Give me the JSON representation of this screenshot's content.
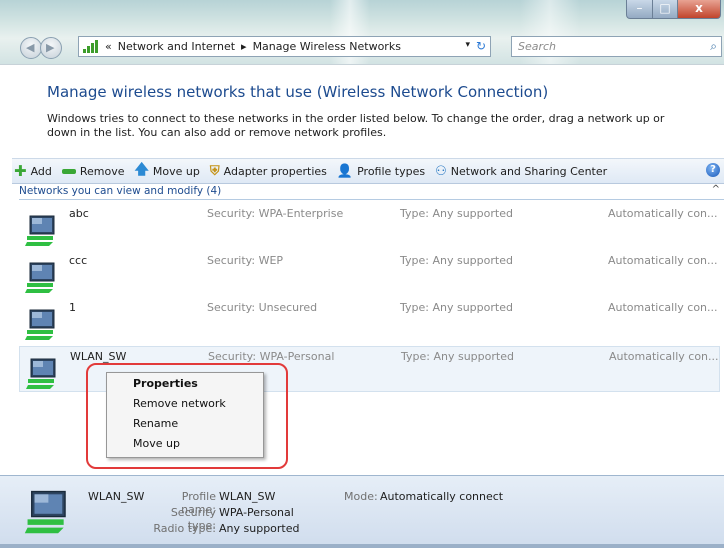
{
  "window": {
    "controls": {
      "minimize": "–",
      "maximize": "□",
      "close": "x"
    }
  },
  "address_bar": {
    "prefix": "«",
    "crumbs": [
      "Network and Internet",
      "Manage Wireless Networks"
    ],
    "separator": "▸",
    "dropdown_icon": "▾",
    "refresh_icon": "↻"
  },
  "search": {
    "placeholder": "Search",
    "icon": "⌕"
  },
  "page": {
    "title": "Manage wireless networks that use (Wireless Network Connection)",
    "description": "Windows tries to connect to these networks in the order listed below. To change the order, drag a network up or down in the list. You can also add or remove network profiles."
  },
  "toolbar": {
    "add": "Add",
    "remove": "Remove",
    "move_up": "Move up",
    "adapter_properties": "Adapter properties",
    "profile_types": "Profile types",
    "network_sharing_center": "Network and Sharing Center",
    "help": "?"
  },
  "group": {
    "label": "Networks you can view and modify (4)",
    "caret": "^"
  },
  "networks": [
    {
      "name": "abc",
      "security": "Security: WPA-Enterprise",
      "type": "Type: Any supported",
      "mode": "Automatically con..."
    },
    {
      "name": "ccc",
      "security": "Security: WEP",
      "type": "Type: Any supported",
      "mode": "Automatically con..."
    },
    {
      "name": "1",
      "security": "Security: Unsecured",
      "type": "Type: Any supported",
      "mode": "Automatically con..."
    },
    {
      "name": "WLAN_SW",
      "security": "Security: WPA-Personal",
      "type": "Type: Any supported",
      "mode": "Automatically con..."
    }
  ],
  "context_menu": {
    "items": [
      "Properties",
      "Remove network",
      "Rename",
      "Move up"
    ]
  },
  "details": {
    "name": "WLAN_SW",
    "profile_name_label": "Profile name:",
    "profile_name": "WLAN_SW",
    "security_type_label": "Security type:",
    "security_type": "WPA-Personal",
    "radio_type_label": "Radio type:",
    "radio_type": "Any supported",
    "mode_label": "Mode:",
    "mode": "Automatically connect"
  },
  "colors": {
    "heading": "#1d4b8f",
    "annotation": "#e23a3a",
    "selected_row": "#eef4fa"
  }
}
